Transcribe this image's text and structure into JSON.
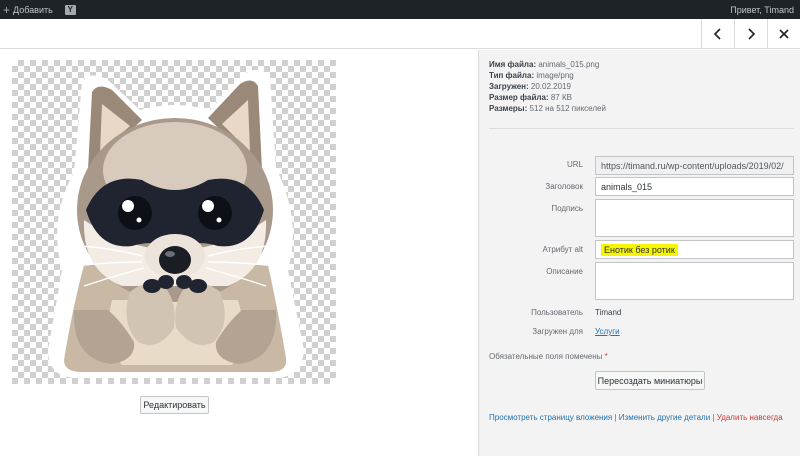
{
  "adminbar": {
    "add_label": "Добавить",
    "yoast_letter": "Y",
    "greeting": "Привет, Timand"
  },
  "header": {
    "prev_icon": "chevron-left-icon",
    "next_icon": "chevron-right-icon",
    "close_icon": "close-icon"
  },
  "media": {
    "edit_label": "Редактировать"
  },
  "fileinfo": {
    "filename_label": "Имя файла:",
    "filename": "animals_015.png",
    "filetype_label": "Тип файла:",
    "filetype": "image/png",
    "uploaded_label": "Загружен:",
    "uploaded": "20.02.2019",
    "size_label": "Размер файла:",
    "size": "87 КВ",
    "dimensions_label": "Размеры:",
    "dimensions": "512 на 512 пикселей"
  },
  "fields": {
    "url_label": "URL",
    "url_value": "https://timand.ru/wp-content/uploads/2019/02/",
    "title_label": "Заголовок",
    "title_value": "animals_015",
    "caption_label": "Подпись",
    "caption_value": "",
    "alt_label": "Атрибут alt",
    "alt_value": "Енотик без ротик",
    "description_label": "Описание",
    "description_value": "",
    "user_label": "Пользователь",
    "user_value": "Timand",
    "uploaded_to_label": "Загружен для",
    "uploaded_to_value": "Услуги"
  },
  "required_note": "Обязательные поля помечены",
  "required_star": "*",
  "regen_label": "Пересоздать миниатюры",
  "actions": {
    "view": "Просмотреть страницу вложения",
    "sep": "|",
    "edit_more": "Изменить другие детали",
    "delete": "Удалить навсегда"
  },
  "colors": {
    "link": "#2271b1",
    "delete": "#d63638",
    "highlight": "#f8f500"
  }
}
